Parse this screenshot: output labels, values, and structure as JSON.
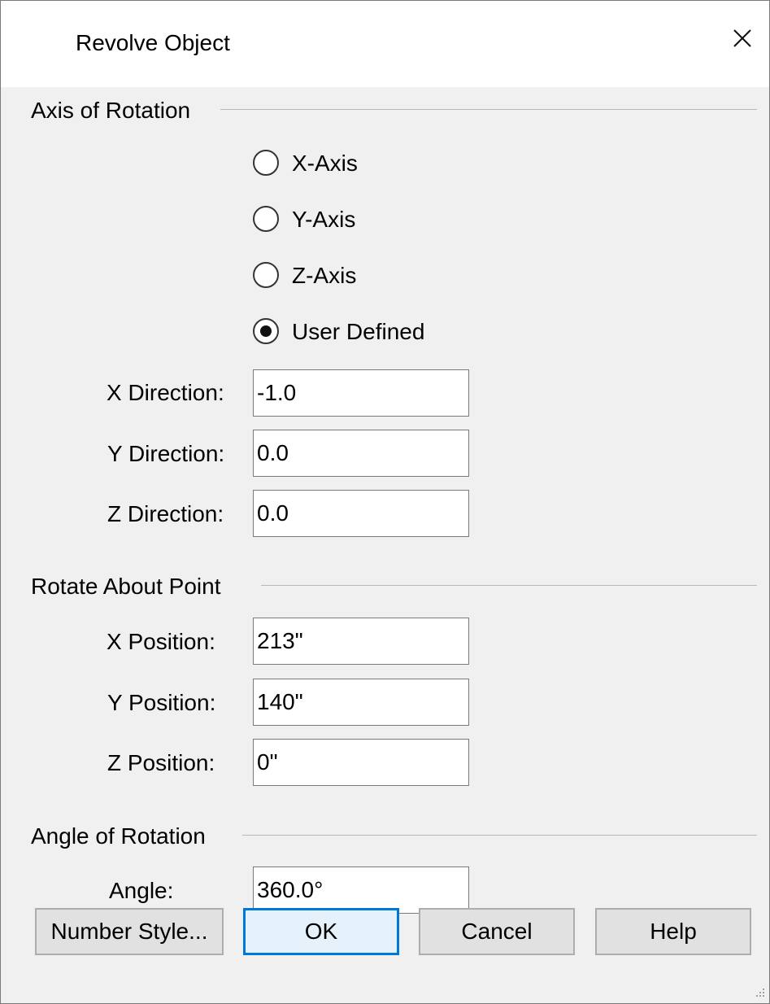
{
  "window": {
    "title": "Revolve Object",
    "close_icon": "close-icon"
  },
  "axis_group": {
    "label": "Axis of Rotation",
    "options": [
      {
        "label": "X-Axis",
        "selected": false
      },
      {
        "label": "Y-Axis",
        "selected": false
      },
      {
        "label": "Z-Axis",
        "selected": false
      },
      {
        "label": "User Defined",
        "selected": true
      }
    ],
    "fields": [
      {
        "label": "X Direction:",
        "value": "-1.0"
      },
      {
        "label": "Y Direction:",
        "value": "0.0"
      },
      {
        "label": "Z Direction:",
        "value": "0.0"
      }
    ]
  },
  "point_group": {
    "label": "Rotate About Point",
    "fields": [
      {
        "label": "X Position:",
        "value": "213\""
      },
      {
        "label": "Y Position:",
        "value": "140\""
      },
      {
        "label": "Z Position:",
        "value": "0\""
      }
    ]
  },
  "angle_group": {
    "label": "Angle of Rotation",
    "field": {
      "label": "Angle:",
      "value": "360.0°"
    }
  },
  "buttons": {
    "number_style": "Number Style...",
    "ok": "OK",
    "cancel": "Cancel",
    "help": "Help"
  },
  "colors": {
    "dialog_bg": "#f0f0f0",
    "accent": "#0078d7"
  }
}
